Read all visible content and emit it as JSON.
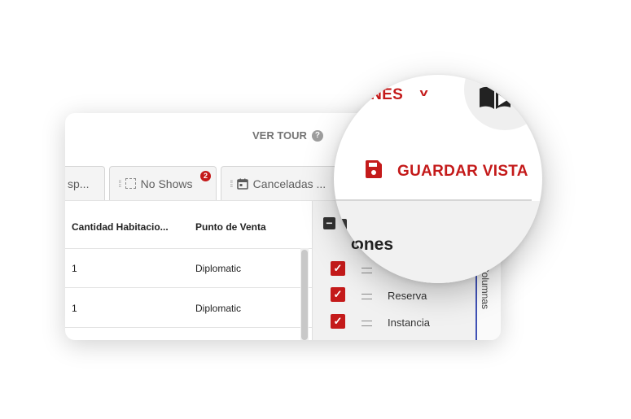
{
  "header": {
    "tour_label": "VER TOUR",
    "tour_help_glyph": "?"
  },
  "tabs": [
    {
      "label": "sp...",
      "icon": null
    },
    {
      "label": "No Shows",
      "icon": "dashed-box-icon",
      "badge": "2"
    },
    {
      "label": "Canceladas ...",
      "icon": "calendar-icon"
    }
  ],
  "table": {
    "columns": [
      "Cantidad Habitacio...",
      "Punto de Venta"
    ],
    "rows": [
      [
        "1",
        "Diplomatic"
      ],
      [
        "1",
        "Diplomatic"
      ]
    ]
  },
  "columns_panel": {
    "toggle_all_glyph": "−",
    "heading": "ones",
    "items": [
      {
        "label": "",
        "checked": true
      },
      {
        "label": "Reserva",
        "checked": true
      },
      {
        "label": "Instancia",
        "checked": true
      }
    ],
    "side_tab_label": "Columnas"
  },
  "magnifier": {
    "menu_label": "ONES",
    "save_label": "GUARDAR VISTA",
    "columns_heading": "ones"
  },
  "colors": {
    "accent": "#c41a1a",
    "side_tab_border": "#3f51b5"
  }
}
